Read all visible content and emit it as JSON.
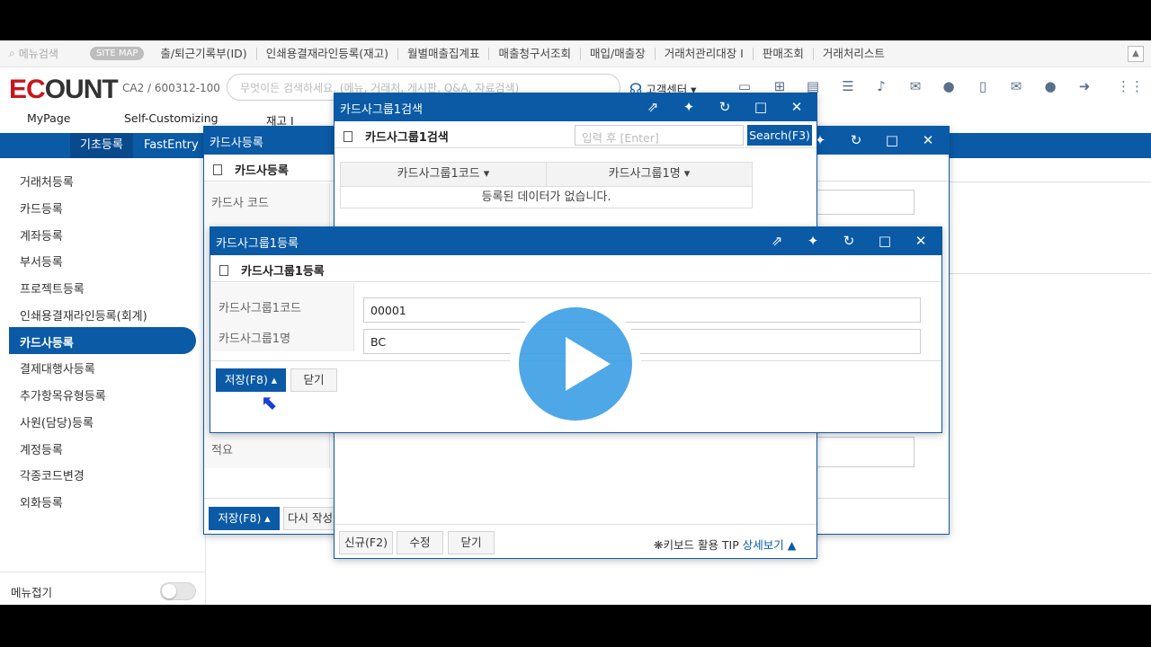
{
  "topnav": {
    "search_placeholder": "메뉴검색",
    "sitemap": "SITE MAP",
    "links": [
      "출/퇴근기록부(ID)",
      "인쇄용결재라인등록(재고)",
      "월별매출집계표",
      "매출청구서조회",
      "매입/매출장",
      "거래처관리대장 I",
      "판매조회",
      "거래처리스트"
    ],
    "more": "▲"
  },
  "header": {
    "logo_a": "EC",
    "logo_b": "OUNT",
    "company": "CA2 / 600312-100",
    "search_placeholder": "무엇이든 검색하세요. (메뉴, 거래처, 게시판, Q&A, 자료검색)",
    "support": "고객센터 ▾"
  },
  "menu2": {
    "mypage": "MyPage",
    "self": "Self-Customizing",
    "stock": "재고 I"
  },
  "bluebar": {
    "tabs": [
      "기초등록",
      "FastEntry"
    ]
  },
  "sidebar": {
    "items": [
      "거래처등록",
      "카드등록",
      "계좌등록",
      "부서등록",
      "프로젝트등록",
      "인쇄용결재라인등록(회계)",
      "카드사등록",
      "결제대행사등록",
      "추가항목유형등록",
      "사원(담당)등록",
      "계정등록",
      "각종코드변경",
      "외화등록"
    ],
    "active": "카드사등록",
    "fold_label": "메뉴접기"
  },
  "win_card": {
    "title": "카드사등록",
    "subhead": "카드사등록",
    "label_code": "카드사 코드",
    "label_memo": "적요",
    "save": "저장(F8)",
    "rewrite": "다시 작성"
  },
  "win_search": {
    "title": "카드사그룹1검색",
    "subhead": "카드사그룹1검색",
    "search_placeholder": "입력 후 [Enter]",
    "search_btn": "Search(F3)",
    "col1": "카드사그룹1코드 ▾",
    "col2": "카드사그룹1명 ▾",
    "empty": "등록된 데이터가 없습니다.",
    "btn_new": "신규(F2)",
    "btn_edit": "수정",
    "btn_close": "닫기",
    "tip": "❋키보드 활용 TIP",
    "tip_more": "상세보기 ▲"
  },
  "win_group": {
    "title": "카드사그룹1등록",
    "subhead": "카드사그룹1등록",
    "label_code": "카드사그룹1코드",
    "code_value": "00001",
    "label_name": "카드사그룹1명",
    "name_value": "BC",
    "save": "저장(F8)",
    "close": "닫기"
  }
}
